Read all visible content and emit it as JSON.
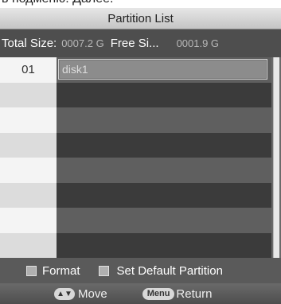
{
  "page_caption": "в подменю. Далее.",
  "title": "Partition List",
  "sizes": {
    "total_label": "Total Size:",
    "total_value": "0007.2 G",
    "free_label": "Free Si...",
    "free_value": "0001.9 G"
  },
  "partitions": [
    {
      "index": "01",
      "name": "disk1",
      "selected": true
    },
    {
      "index": "",
      "name": ""
    },
    {
      "index": "",
      "name": ""
    },
    {
      "index": "",
      "name": ""
    },
    {
      "index": "",
      "name": ""
    },
    {
      "index": "",
      "name": ""
    },
    {
      "index": "",
      "name": ""
    },
    {
      "index": "",
      "name": ""
    }
  ],
  "legend": {
    "format_label": "Format",
    "set_default_label": "Set Default Partition"
  },
  "footer": {
    "move_key": "▲▼",
    "move_label": "Move",
    "menu_key": "Menu",
    "return_label": "Return"
  },
  "colors": {
    "background": "#5a5a5a",
    "title_bar": "#d6d6d6",
    "index_column": "#f4f4f4",
    "selection": "#8c8c8c"
  }
}
